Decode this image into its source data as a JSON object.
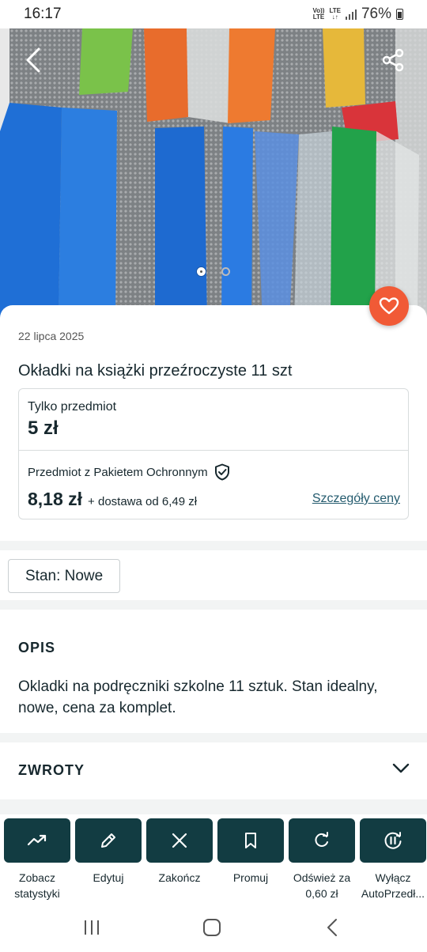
{
  "status_bar": {
    "time": "16:17",
    "volte": "Vo))\nLTE",
    "lte": "LTE\n↓↑",
    "battery": "76%"
  },
  "hero": {
    "image_count": 2,
    "active_index": 0,
    "icons": {
      "back": "arrow-left-icon",
      "share": "share-icon"
    }
  },
  "item": {
    "date": "22 lipca 2025",
    "title": "Okładki na książki przeźroczyste 11 szt"
  },
  "pricing": {
    "only_item_label": "Tylko przedmiot",
    "only_item_price": "5 zł",
    "protected_label": "Przedmiot z Pakietem Ochronnym",
    "protected_price": "8,18 zł",
    "shipping": "+ dostawa od 6,49 zł",
    "details_link": "Szczegóły ceny"
  },
  "condition": {
    "label": "Stan: Nowe"
  },
  "description": {
    "heading": "OPIS",
    "text": "Okladki na podręczniki szkolne 11 sztuk. Stan idealny, nowe, cena za komplet."
  },
  "returns": {
    "heading": "ZWROTY"
  },
  "actions": [
    {
      "icon": "trending-up-icon",
      "label": "Zobacz\nstatystyki"
    },
    {
      "icon": "pencil-icon",
      "label": "Edytuj"
    },
    {
      "icon": "close-icon",
      "label": "Zakończ"
    },
    {
      "icon": "bookmark-icon",
      "label": "Promuj"
    },
    {
      "icon": "refresh-icon",
      "label": "Odśwież za\n0,60 zł"
    },
    {
      "icon": "pause-autorefresh-icon",
      "label": "Wyłącz\nAutoPrzedł..."
    }
  ],
  "colors": {
    "accent": "#f15a36",
    "action_bg": "#123c42",
    "link": "#245b6e",
    "text": "#17282e"
  }
}
